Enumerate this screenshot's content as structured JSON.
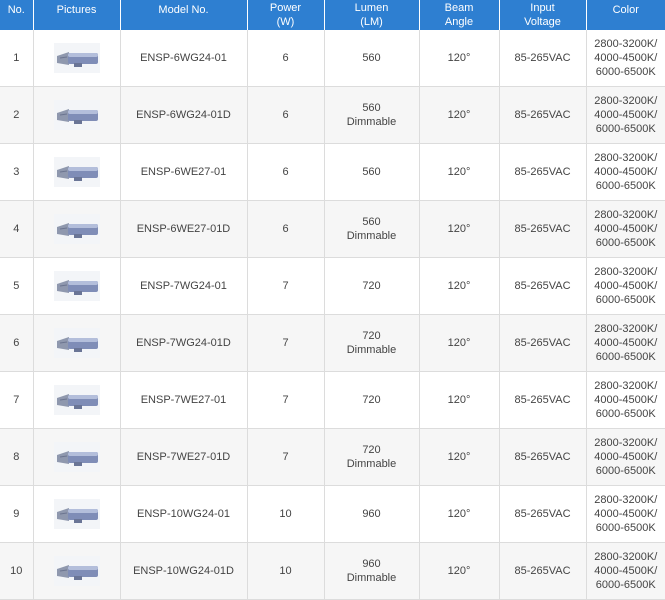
{
  "headers": {
    "no": "No.",
    "pictures": "Pictures",
    "model": "Model No.",
    "power": [
      "Power",
      "(W)"
    ],
    "lumen": [
      "Lumen",
      "(LM)"
    ],
    "beam": [
      "Beam",
      "Angle"
    ],
    "input": [
      "Input",
      "Voltage"
    ],
    "color": "Color"
  },
  "rows": [
    {
      "no": "1",
      "model": "ENSP-6WG24-01",
      "power": "6",
      "lumen": "560",
      "dim": "",
      "beam": "120°",
      "voltage": "85-265VAC",
      "color": [
        "2800-3200K/",
        "4000-4500K/",
        "6000-6500K"
      ]
    },
    {
      "no": "2",
      "model": "ENSP-6WG24-01D",
      "power": "6",
      "lumen": "560",
      "dim": "Dimmable",
      "beam": "120°",
      "voltage": "85-265VAC",
      "color": [
        "2800-3200K/",
        "4000-4500K/",
        "6000-6500K"
      ]
    },
    {
      "no": "3",
      "model": "ENSP-6WE27-01",
      "power": "6",
      "lumen": "560",
      "dim": "",
      "beam": "120°",
      "voltage": "85-265VAC",
      "color": [
        "2800-3200K/",
        "4000-4500K/",
        "6000-6500K"
      ]
    },
    {
      "no": "4",
      "model": "ENSP-6WE27-01D",
      "power": "6",
      "lumen": "560",
      "dim": "Dimmable",
      "beam": "120°",
      "voltage": "85-265VAC",
      "color": [
        "2800-3200K/",
        "4000-4500K/",
        "6000-6500K"
      ]
    },
    {
      "no": "5",
      "model": "ENSP-7WG24-01",
      "power": "7",
      "lumen": "720",
      "dim": "",
      "beam": "120°",
      "voltage": "85-265VAC",
      "color": [
        "2800-3200K/",
        "4000-4500K/",
        "6000-6500K"
      ]
    },
    {
      "no": "6",
      "model": "ENSP-7WG24-01D",
      "power": "7",
      "lumen": "720",
      "dim": "Dimmable",
      "beam": "120°",
      "voltage": "85-265VAC",
      "color": [
        "2800-3200K/",
        "4000-4500K/",
        "6000-6500K"
      ]
    },
    {
      "no": "7",
      "model": "ENSP-7WE27-01",
      "power": "7",
      "lumen": "720",
      "dim": "",
      "beam": "120°",
      "voltage": "85-265VAC",
      "color": [
        "2800-3200K/",
        "4000-4500K/",
        "6000-6500K"
      ]
    },
    {
      "no": "8",
      "model": "ENSP-7WE27-01D",
      "power": "7",
      "lumen": "720",
      "dim": "Dimmable",
      "beam": "120°",
      "voltage": "85-265VAC",
      "color": [
        "2800-3200K/",
        "4000-4500K/",
        "6000-6500K"
      ]
    },
    {
      "no": "9",
      "model": "ENSP-10WG24-01",
      "power": "10",
      "lumen": "960",
      "dim": "",
      "beam": "120°",
      "voltage": "85-265VAC",
      "color": [
        "2800-3200K/",
        "4000-4500K/",
        "6000-6500K"
      ]
    },
    {
      "no": "10",
      "model": "ENSP-10WG24-01D",
      "power": "10",
      "lumen": "960",
      "dim": "Dimmable",
      "beam": "120°",
      "voltage": "85-265VAC",
      "color": [
        "2800-3200K/",
        "4000-4500K/",
        "6000-6500K"
      ]
    }
  ],
  "colors": {
    "header_bg": "#2e7fd1",
    "header_text": "#ffffff",
    "row_alt": "#f6f6f6",
    "border": "#dcdcdc"
  },
  "icons": {
    "product_picture": "led-lamp-icon"
  }
}
